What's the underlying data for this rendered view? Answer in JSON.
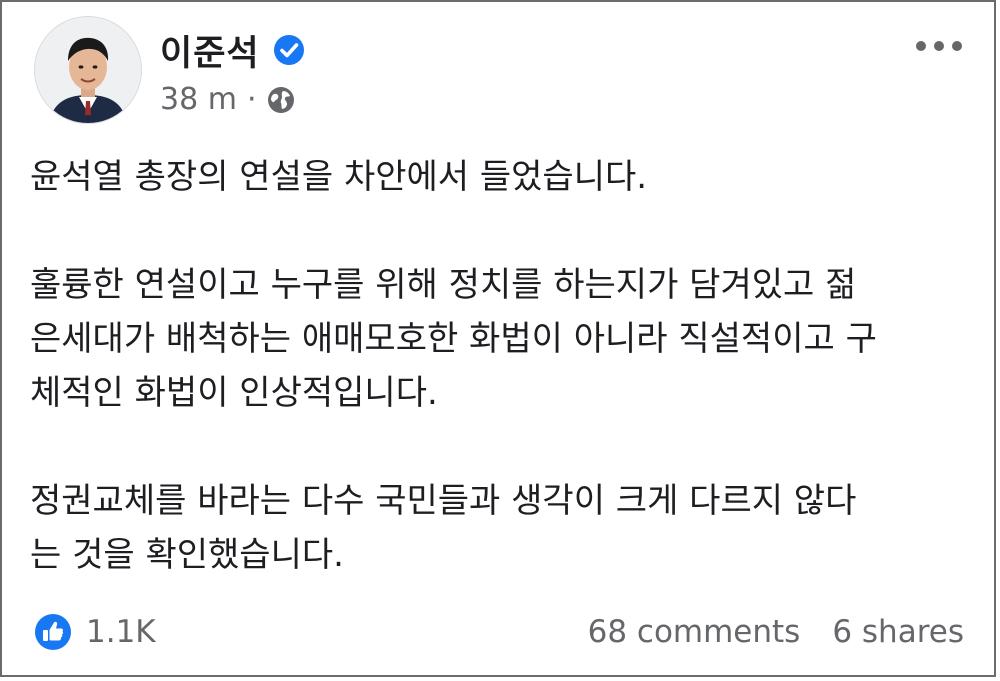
{
  "post": {
    "author": {
      "name": "이준석",
      "verified": true,
      "avatar_icon": "profile-photo"
    },
    "timestamp": "38 m",
    "separator": "·",
    "audience_icon": "globe-icon",
    "paragraphs": [
      "윤석열 총장의 연설을 차안에서 들었습니다.",
      "훌륭한 연설이고 누구를 위해 정치를 하는지가 담겨있고 젊\n은세대가 배척하는 애매모호한 화법이 아니라 직설적이고 구\n체적인 화법이 인상적입니다.",
      "정권교체를 바라는 다수 국민들과 생각이 크게 다르지 않다\n는 것을 확인했습니다."
    ],
    "reactions": {
      "like_count": "1.1K",
      "comments": "68 comments",
      "shares": "6 shares"
    }
  },
  "colors": {
    "accent": "#1877f2",
    "secondary_text": "#65676b",
    "primary_text": "#1c1e21",
    "border": "#6b6b6b"
  }
}
